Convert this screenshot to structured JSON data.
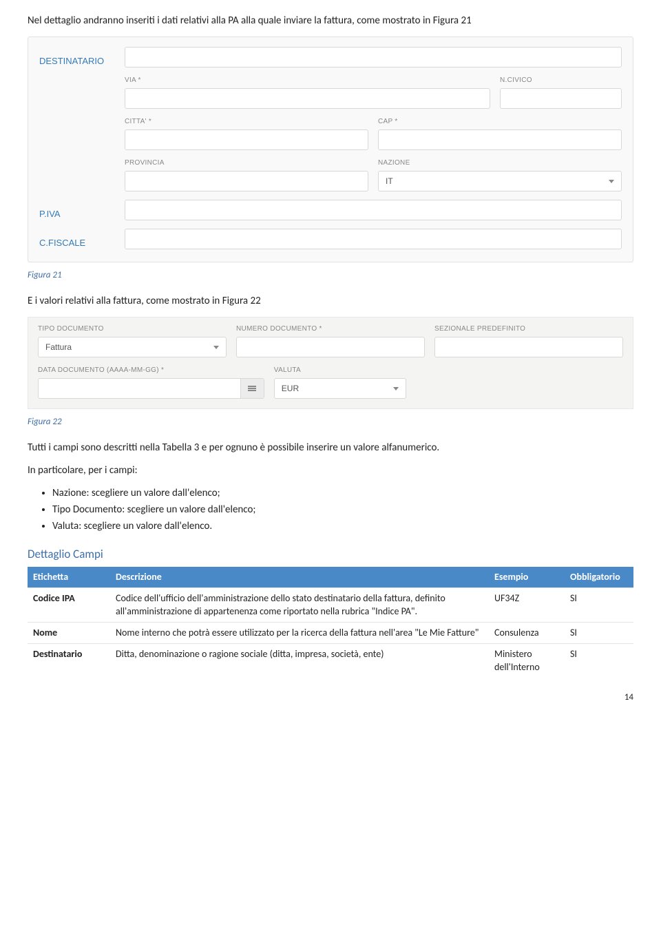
{
  "intro": "Nel dettaglio andranno inseriti i dati relativi alla PA alla quale inviare la fattura, come mostrato in Figura 21",
  "caption1": "Figura 21",
  "mid_text": "E i valori relativi alla fattura, come mostrato in Figura 22",
  "caption2": "Figura 22",
  "after_fig22_1": "Tutti i campi sono descritti nella Tabella 3 e per ognuno è possibile inserire un valore alfanumerico.",
  "after_fig22_2": "In particolare, per i campi:",
  "bullets": [
    "Nazione: scegliere un valore dall'elenco;",
    "Tipo Documento: scegliere un valore dall'elenco;",
    "Valuta: scegliere un valore dall'elenco."
  ],
  "heading_dettaglio": "Dettaglio Campi",
  "form1": {
    "destinatario": "DESTINATARIO",
    "via": "VIA *",
    "ncivico": "N.CIVICO",
    "citta": "CITTA' *",
    "cap": "CAP *",
    "provincia": "PROVINCIA",
    "nazione": "NAZIONE",
    "nazione_value": "IT",
    "piva": "P.IVA",
    "cfiscale": "C.FISCALE"
  },
  "form2": {
    "tipo_doc": "TIPO DOCUMENTO",
    "tipo_doc_value": "Fattura",
    "num_doc": "NUMERO DOCUMENTO *",
    "sez": "SEZIONALE PREDEFINITO",
    "data_doc": "DATA DOCUMENTO (aaaa-mm-gg) *",
    "valuta": "VALUTA",
    "valuta_value": "EUR"
  },
  "table": {
    "headers": {
      "etichetta": "Etichetta",
      "descrizione": "Descrizione",
      "esempio": "Esempio",
      "obbligatorio": "Obbligatorio"
    },
    "rows": [
      {
        "name": "Codice IPA",
        "desc": "Codice dell'ufficio dell'amministrazione dello stato destinatario della fattura, definito all'amministrazione di appartenenza come riportato nella rubrica \"Indice PA\".",
        "ex": "UF34Z",
        "obb": "SI"
      },
      {
        "name": "Nome",
        "desc": "Nome interno che potrà essere utilizzato per la ricerca della fattura nell'area \"Le Mie Fatture\"",
        "ex": "Consulenza",
        "obb": "SI"
      },
      {
        "name": "Destinatario",
        "desc": "Ditta, denominazione o ragione sociale (ditta, impresa, società, ente)",
        "ex": "Ministero dell'Interno",
        "obb": "SI"
      }
    ]
  },
  "page_number": "14"
}
